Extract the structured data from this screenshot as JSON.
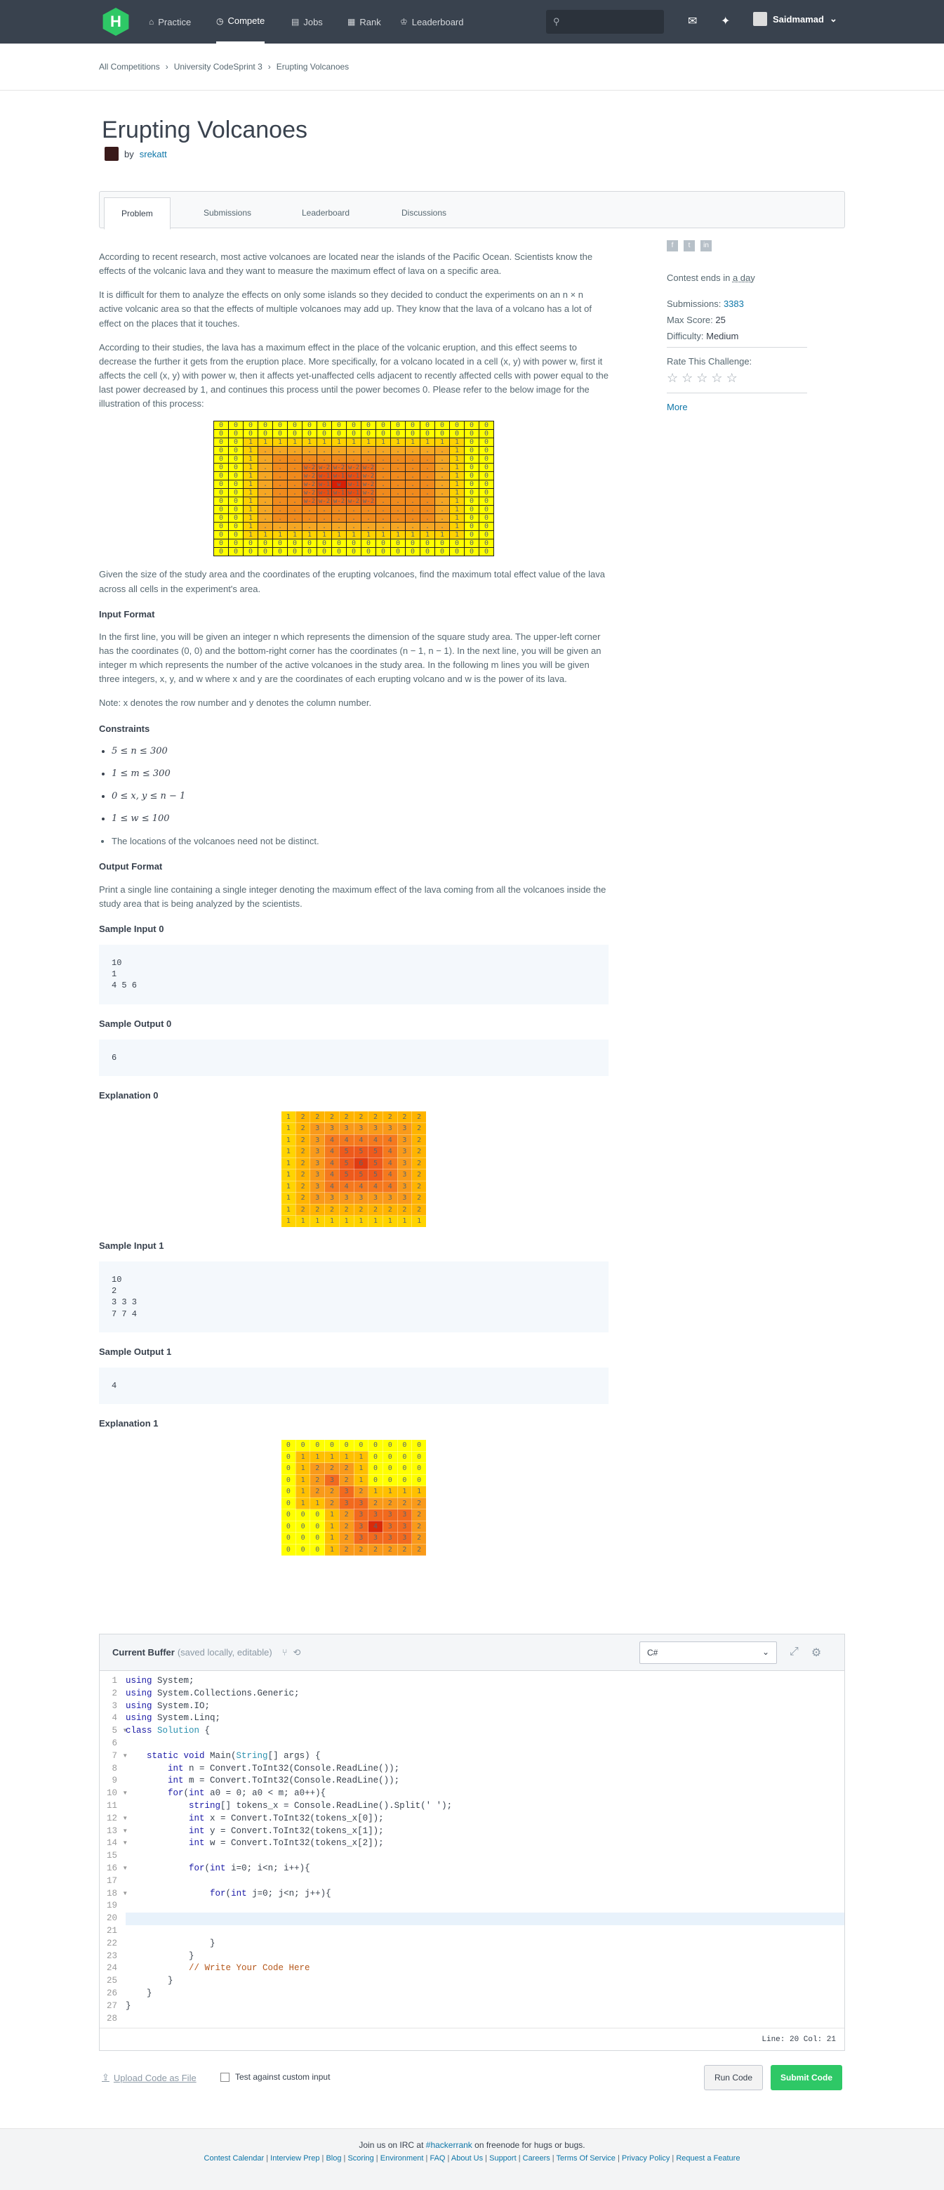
{
  "nav": {
    "logo": "H",
    "items": [
      {
        "label": "Practice",
        "icon": "home-icon"
      },
      {
        "label": "Compete",
        "icon": "clock-icon"
      },
      {
        "label": "Jobs",
        "icon": "briefcase-icon"
      },
      {
        "label": "Rank",
        "icon": "rank-icon"
      },
      {
        "label": "Leaderboard",
        "icon": "trophy-icon"
      }
    ],
    "username": "Saidmamad"
  },
  "breadcrumb": [
    "All Competitions",
    "University CodeSprint 3",
    "Erupting Volcanoes"
  ],
  "title": "Erupting Volcanoes",
  "author_by": "by",
  "author": "srekatt",
  "tabs": [
    "Problem",
    "Submissions",
    "Leaderboard",
    "Discussions"
  ],
  "problem": {
    "p1": "According to recent research, most active volcanoes are located near the islands of the Pacific Ocean. Scientists know the effects of the volcanic lava and they want to measure the maximum effect of lava on a specific area.",
    "p2": "It is difficult for them to analyze the effects on only some islands so they decided to conduct the experiments on an n × n active volcanic area so that the effects of multiple volcanoes may add up. They know that the lava of a volcano has a lot of effect on the places that it touches.",
    "p3": "According to their studies, the lava has a maximum effect in the place of the volcanic eruption, and this effect seems to decrease the further it gets from the eruption place. More specifically, for a volcano located in a cell (x, y) with power w, first it affects the cell (x, y) with power w, then it affects yet-unaffected cells adjacent to recently affected cells with power equal to the last power decreased by 1, and continues this process until the power becomes 0. Please refer to the below image for the illustration of this process:",
    "p4": "Given the size of the study area and the coordinates of the erupting volcanoes, find the maximum total effect value of the lava across all cells in the experiment's area.",
    "input_format_title": "Input Format",
    "input_format": "In the first line, you will be given an integer n which represents the dimension of the square study area. The upper-left corner has the coordinates (0, 0) and the bottom-right corner has the coordinates (n − 1, n − 1). In the next line, you will be given an integer m which represents the number of the active volcanoes in the study area. In the following m lines you will be given three integers, x, y, and w where x and y are the coordinates of each erupting volcano and w is the power of its lava.",
    "note": "Note: x denotes the row number and y denotes the column number.",
    "constraints_title": "Constraints",
    "constraints": [
      "5 ≤ n ≤ 300",
      "1 ≤ m ≤ 300",
      "0 ≤ x, y ≤ n − 1",
      "1 ≤ w ≤ 100"
    ],
    "constraint_note": "The locations of the volcanoes need not be distinct.",
    "output_format_title": "Output Format",
    "output_format": "Print a single line containing a single integer denoting the maximum effect of the lava coming from all the volcanoes inside the study area that is being analyzed by the scientists.",
    "sample_input_0_title": "Sample Input 0",
    "sample_input_0": "10\n1\n4 5 6",
    "sample_output_0_title": "Sample Output 0",
    "sample_output_0": "6",
    "explanation_0_title": "Explanation 0",
    "sample_input_1_title": "Sample Input 1",
    "sample_input_1": "10\n2\n3 3 3\n7 7 4",
    "sample_output_1_title": "Sample Output 1",
    "sample_output_1": "4",
    "explanation_1_title": "Explanation 1"
  },
  "illustration_grid": [
    [
      "0",
      "0",
      "0",
      "0",
      "0",
      "0",
      "0",
      "0",
      "0",
      "0",
      "0",
      "0",
      "0",
      "0",
      "0",
      "0",
      "0",
      "0",
      "0"
    ],
    [
      "0",
      "0",
      "0",
      "0",
      "0",
      "0",
      "0",
      "0",
      "0",
      "0",
      "0",
      "0",
      "0",
      "0",
      "0",
      "0",
      "0",
      "0",
      "0"
    ],
    [
      "0",
      "0",
      "1",
      "1",
      "1",
      "1",
      "1",
      "1",
      "1",
      "1",
      "1",
      "1",
      "1",
      "1",
      "1",
      "1",
      "1",
      "0",
      "0"
    ],
    [
      "0",
      "0",
      "1",
      ".",
      ".",
      ".",
      ".",
      ".",
      ".",
      ".",
      ".",
      ".",
      ".",
      ".",
      ".",
      ".",
      "1",
      "0",
      "0"
    ],
    [
      "0",
      "0",
      "1",
      ".",
      ".",
      ".",
      ".",
      ".",
      ".",
      ".",
      ".",
      ".",
      ".",
      ".",
      ".",
      ".",
      "1",
      "0",
      "0"
    ],
    [
      "0",
      "0",
      "1",
      ".",
      ".",
      ".",
      "w-2",
      "w-2",
      "w-2",
      "w-2",
      "w-2",
      ".",
      ".",
      ".",
      ".",
      ".",
      "1",
      "0",
      "0"
    ],
    [
      "0",
      "0",
      "1",
      ".",
      ".",
      ".",
      "w-2",
      "w-1",
      "w-1",
      "w-1",
      "w-2",
      ".",
      ".",
      ".",
      ".",
      ".",
      "1",
      "0",
      "0"
    ],
    [
      "0",
      "0",
      "1",
      ".",
      ".",
      ".",
      "w-2",
      "w-1",
      "w",
      "w-1",
      "w-2",
      ".",
      ".",
      ".",
      ".",
      ".",
      "1",
      "0",
      "0"
    ],
    [
      "0",
      "0",
      "1",
      ".",
      ".",
      ".",
      "w-2",
      "w-1",
      "w-1",
      "w-1",
      "w-2",
      ".",
      ".",
      ".",
      ".",
      ".",
      "1",
      "0",
      "0"
    ],
    [
      "0",
      "0",
      "1",
      ".",
      ".",
      ".",
      "w-2",
      "w-2",
      "w-2",
      "w-2",
      "w-2",
      ".",
      ".",
      ".",
      ".",
      ".",
      "1",
      "0",
      "0"
    ],
    [
      "0",
      "0",
      "1",
      ".",
      ".",
      ".",
      ".",
      ".",
      ".",
      ".",
      ".",
      ".",
      ".",
      ".",
      ".",
      ".",
      "1",
      "0",
      "0"
    ],
    [
      "0",
      "0",
      "1",
      ".",
      ".",
      ".",
      ".",
      ".",
      ".",
      ".",
      ".",
      ".",
      ".",
      ".",
      ".",
      ".",
      "1",
      "0",
      "0"
    ],
    [
      "0",
      "0",
      "1",
      ".",
      ".",
      ".",
      ".",
      ".",
      ".",
      ".",
      ".",
      ".",
      ".",
      ".",
      ".",
      ".",
      "1",
      "0",
      "0"
    ],
    [
      "0",
      "0",
      "1",
      "1",
      "1",
      "1",
      "1",
      "1",
      "1",
      "1",
      "1",
      "1",
      "1",
      "1",
      "1",
      "1",
      "1",
      "0",
      "0"
    ],
    [
      "0",
      "0",
      "0",
      "0",
      "0",
      "0",
      "0",
      "0",
      "0",
      "0",
      "0",
      "0",
      "0",
      "0",
      "0",
      "0",
      "0",
      "0",
      "0"
    ],
    [
      "0",
      "0",
      "0",
      "0",
      "0",
      "0",
      "0",
      "0",
      "0",
      "0",
      "0",
      "0",
      "0",
      "0",
      "0",
      "0",
      "0",
      "0",
      "0"
    ]
  ],
  "explanation_0_grid": [
    [
      1,
      2,
      2,
      2,
      2,
      2,
      2,
      2,
      2,
      2
    ],
    [
      1,
      2,
      3,
      3,
      3,
      3,
      3,
      3,
      3,
      2
    ],
    [
      1,
      2,
      3,
      4,
      4,
      4,
      4,
      4,
      3,
      2
    ],
    [
      1,
      2,
      3,
      4,
      5,
      5,
      5,
      4,
      3,
      2
    ],
    [
      1,
      2,
      3,
      4,
      5,
      6,
      5,
      4,
      3,
      2
    ],
    [
      1,
      2,
      3,
      4,
      5,
      5,
      5,
      4,
      3,
      2
    ],
    [
      1,
      2,
      3,
      4,
      4,
      4,
      4,
      4,
      3,
      2
    ],
    [
      1,
      2,
      3,
      3,
      3,
      3,
      3,
      3,
      3,
      2
    ],
    [
      1,
      2,
      2,
      2,
      2,
      2,
      2,
      2,
      2,
      2
    ],
    [
      1,
      1,
      1,
      1,
      1,
      1,
      1,
      1,
      1,
      1
    ]
  ],
  "explanation_1_grid": [
    [
      0,
      0,
      0,
      0,
      0,
      0,
      0,
      0,
      0,
      0
    ],
    [
      0,
      1,
      1,
      1,
      1,
      1,
      0,
      0,
      0,
      0
    ],
    [
      0,
      1,
      2,
      2,
      2,
      1,
      0,
      0,
      0,
      0
    ],
    [
      0,
      1,
      2,
      3,
      2,
      1,
      0,
      0,
      0,
      0
    ],
    [
      0,
      1,
      2,
      2,
      3,
      2,
      1,
      1,
      1,
      1
    ],
    [
      0,
      1,
      1,
      2,
      3,
      3,
      2,
      2,
      2,
      2
    ],
    [
      0,
      0,
      0,
      1,
      2,
      3,
      3,
      3,
      3,
      2
    ],
    [
      0,
      0,
      0,
      1,
      2,
      3,
      4,
      3,
      3,
      2
    ],
    [
      0,
      0,
      0,
      1,
      2,
      3,
      3,
      3,
      3,
      2
    ],
    [
      0,
      0,
      0,
      1,
      2,
      2,
      2,
      2,
      2,
      2
    ]
  ],
  "sidebar": {
    "contest_ends_label": "Contest ends in",
    "contest_ends_value": "a day",
    "submissions_label": "Submissions:",
    "submissions_value": "3383",
    "max_score_label": "Max Score:",
    "max_score_value": "25",
    "difficulty_label": "Difficulty:",
    "difficulty_value": "Medium",
    "rate_label": "Rate This Challenge:",
    "more": "More"
  },
  "editor": {
    "buffer_label": "Current Buffer",
    "buffer_note": "(saved locally, editable)",
    "language": "C#",
    "status": "Line: 20 Col: 21"
  },
  "actions": {
    "upload": "Upload Code as File",
    "custom_input": "Test against custom input",
    "run": "Run Code",
    "submit": "Submit Code"
  },
  "footer": {
    "irc_text_1": "Join us on IRC at",
    "irc_channel": "#hackerrank",
    "irc_text_2": "on freenode for hugs or bugs.",
    "links": [
      "Contest Calendar",
      "Interview Prep",
      "Blog",
      "Scoring",
      "Environment",
      "FAQ",
      "About Us",
      "Support",
      "Careers",
      "Terms Of Service",
      "Privacy Policy",
      "Request a Feature"
    ]
  },
  "colors": {
    "nav_bg": "#39424e",
    "brand_green": "#2ec866",
    "link_blue": "#0e76a8"
  }
}
